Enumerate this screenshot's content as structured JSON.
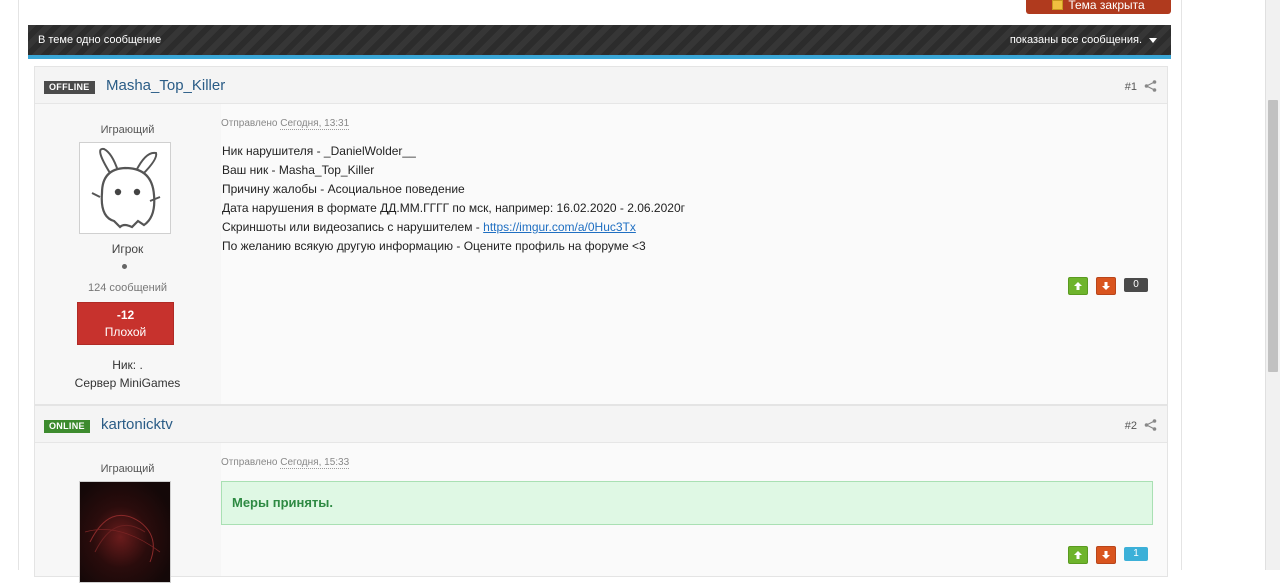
{
  "topic": {
    "closed_button": "Тема закрыта",
    "bar_left": "В теме одно сообщение",
    "bar_right": "показаны все сообщения."
  },
  "posts": [
    {
      "status": "OFFLINE",
      "author": "Masha_Top_Killer",
      "number": "#1",
      "role": "Играющий",
      "rank": "Игрок",
      "message_count": "124 сообщений",
      "reputation_value": "-12",
      "reputation_label": "Плохой",
      "nick_line": "Ник: .",
      "server_label": "Сервер",
      "server_value": "MiniGames",
      "posted_prefix": "Отправлено",
      "posted_time": "Сегодня, 13:31",
      "lines": [
        "Ник нарушителя - _DanielWolder__",
        "Ваш ник - Masha_Top_Killer",
        "Причину жалобы - Асоциальное поведение",
        "Дата нарушения в формате ДД.ММ.ГГГГ по мск, например: 16.02.2020 - 2.06.2020г"
      ],
      "evidence_prefix": "Скриншоты или видеозапись с нарушителем - ",
      "evidence_link": "https://imgur.com/a/0Huc3Tx",
      "extra_line": "По желанию всякую другую информацию - Оцените профиль на форуме <3",
      "score": "0"
    },
    {
      "status": "ONLINE",
      "author": "kartonicktv",
      "number": "#2",
      "role": "Играющий",
      "posted_prefix": "Отправлено",
      "posted_time": "Сегодня, 15:33",
      "notice": "Меры приняты.",
      "score": "1"
    }
  ],
  "colors": {
    "link": "#2a5c86",
    "reputation_bad": "#c7322d",
    "vote_up": "#6eb42c",
    "vote_down": "#d9541e",
    "notice_bg": "#dff8e4",
    "accent_line": "#3aa6d6"
  }
}
